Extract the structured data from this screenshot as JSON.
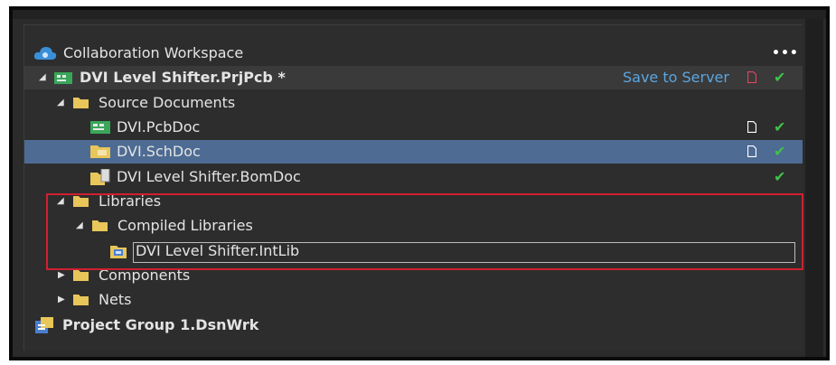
{
  "workspace": {
    "title": "Collaboration Workspace",
    "menu": "•••"
  },
  "project": {
    "name": "DVI Level Shifter.PrjPcb *",
    "save_label": "Save to Server"
  },
  "tree": {
    "source_documents": "Source Documents",
    "pcb_doc": "DVI.PcbDoc",
    "sch_doc": "DVI.SchDoc",
    "bom_doc": "DVI Level Shifter.BomDoc",
    "libraries": "Libraries",
    "compiled_libraries": "Compiled Libraries",
    "intlib": "DVI Level Shifter.IntLib",
    "components": "Components",
    "nets": "Nets"
  },
  "project_group": "Project Group 1.DsnWrk",
  "icons": {
    "check": "✔",
    "expanded": "◢",
    "collapsed": "▶"
  },
  "colors": {
    "selection": "#4d6b93",
    "accent": "#5aa6e0",
    "check": "#3fc24a",
    "highlight": "#d02030",
    "folder": "#e8c65a"
  }
}
